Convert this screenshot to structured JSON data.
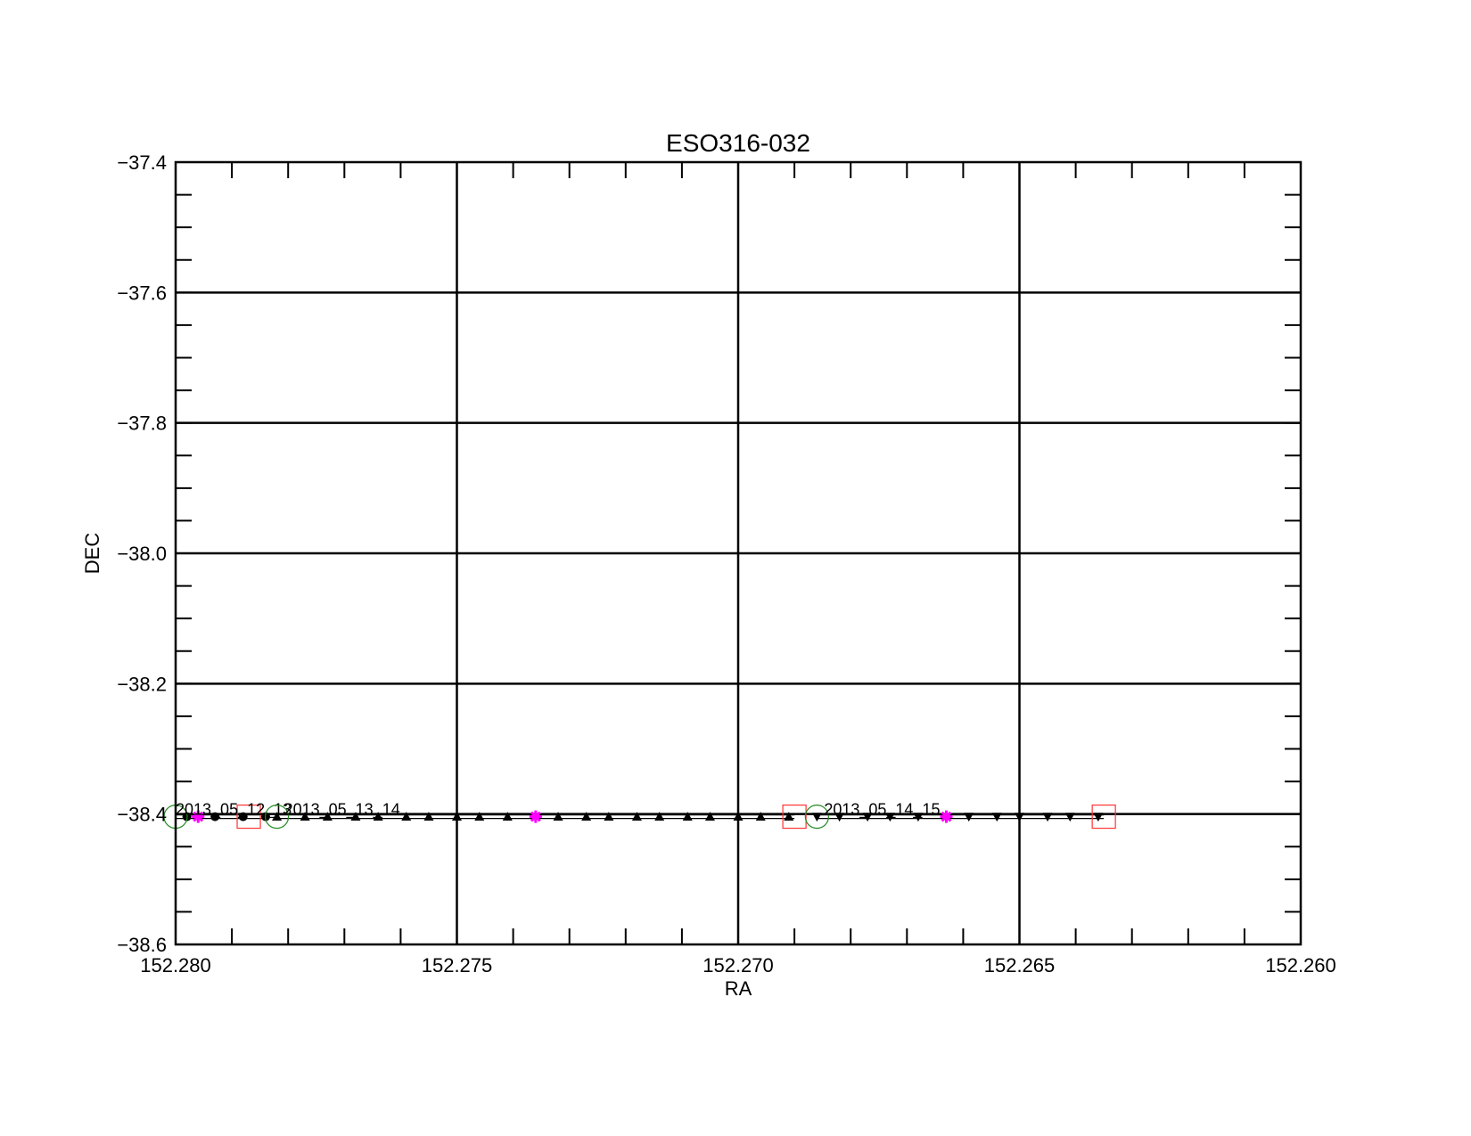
{
  "chart_data": {
    "type": "scatter",
    "title": "ESO316-032",
    "xlabel": "RA",
    "ylabel": "DEC",
    "xlim": [
      152.28,
      152.26
    ],
    "ylim": [
      -38.6,
      -37.4
    ],
    "x_reversed": true,
    "grid": true,
    "x_ticks": [
      152.28,
      152.275,
      152.27,
      152.265,
      152.26
    ],
    "x_tick_labels": [
      "152.280",
      "152.275",
      "152.270",
      "152.265",
      "152.260"
    ],
    "y_ticks": [
      -37.4,
      -37.6,
      -37.8,
      -38.0,
      -38.2,
      -38.4,
      -38.6
    ],
    "y_tick_labels": [
      "−37.4",
      "−37.6",
      "−37.8",
      "−38.0",
      "−38.2",
      "−38.4",
      "−38.6"
    ],
    "series": [
      {
        "label": "2013_05_12_13",
        "marker": "circle",
        "x": [
          152.2798,
          152.2793,
          152.2788,
          152.2784
        ],
        "y": [
          -38.404,
          -38.404,
          -38.404,
          -38.404
        ],
        "start_x": 152.28,
        "end_x": 152.2787,
        "mid_x": 152.2796
      },
      {
        "label": "2013_05_13_14",
        "marker": "triangle-up",
        "x": [
          152.2782,
          152.2777,
          152.2773,
          152.2768,
          152.2764,
          152.2759,
          152.2755,
          152.275,
          152.2746,
          152.2741,
          152.2732,
          152.2727,
          152.2723,
          152.2718,
          152.2714,
          152.2709,
          152.2705,
          152.27,
          152.2696,
          152.2691
        ],
        "y": [
          -38.404,
          -38.404,
          -38.404,
          -38.404,
          -38.404,
          -38.404,
          -38.404,
          -38.404,
          -38.404,
          -38.404,
          -38.404,
          -38.404,
          -38.404,
          -38.404,
          -38.404,
          -38.404,
          -38.404,
          -38.404,
          -38.404,
          -38.404
        ],
        "start_x": 152.2782,
        "end_x": 152.269,
        "mid_x": 152.2736
      },
      {
        "label": "2013_05_14_15",
        "marker": "triangle-down",
        "x": [
          152.2686,
          152.2682,
          152.2677,
          152.2673,
          152.2668,
          152.2659,
          152.2654,
          152.265,
          152.2645,
          152.2641,
          152.2636
        ],
        "y": [
          -38.404,
          -38.404,
          -38.404,
          -38.404,
          -38.404,
          -38.404,
          -38.404,
          -38.404,
          -38.404,
          -38.404,
          -38.404
        ],
        "start_x": 152.2686,
        "end_x": 152.2635,
        "mid_x": 152.2663
      }
    ],
    "marker_legend": {
      "start": "green-circle",
      "end": "red-square",
      "midpoint": "magenta-asterisk"
    },
    "colors": {
      "start": "#228b22",
      "end": "#ff3333",
      "midpoint": "#ff00ff",
      "axes": "#000000"
    }
  }
}
